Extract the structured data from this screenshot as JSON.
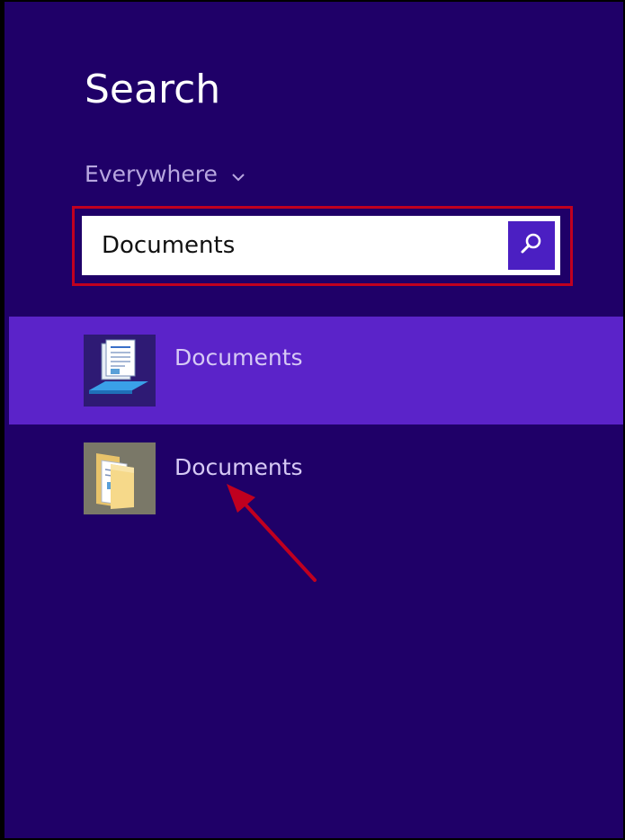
{
  "search_pane": {
    "title": "Search",
    "scope": {
      "label": "Everywhere",
      "icon": "chevron-down-icon"
    },
    "search_box": {
      "value": "Documents",
      "button_icon": "search-icon"
    },
    "results": [
      {
        "label": "Documents",
        "icon": "library-documents-icon",
        "selected": true
      },
      {
        "label": "Documents",
        "icon": "folder-documents-icon",
        "selected": false
      }
    ]
  },
  "annotations": {
    "highlight_color": "#c0001f",
    "arrow_color": "#c0001f"
  },
  "colors": {
    "background": "#1f0068",
    "selected_result": "#5b23c9",
    "search_button": "#4b1fc2"
  }
}
